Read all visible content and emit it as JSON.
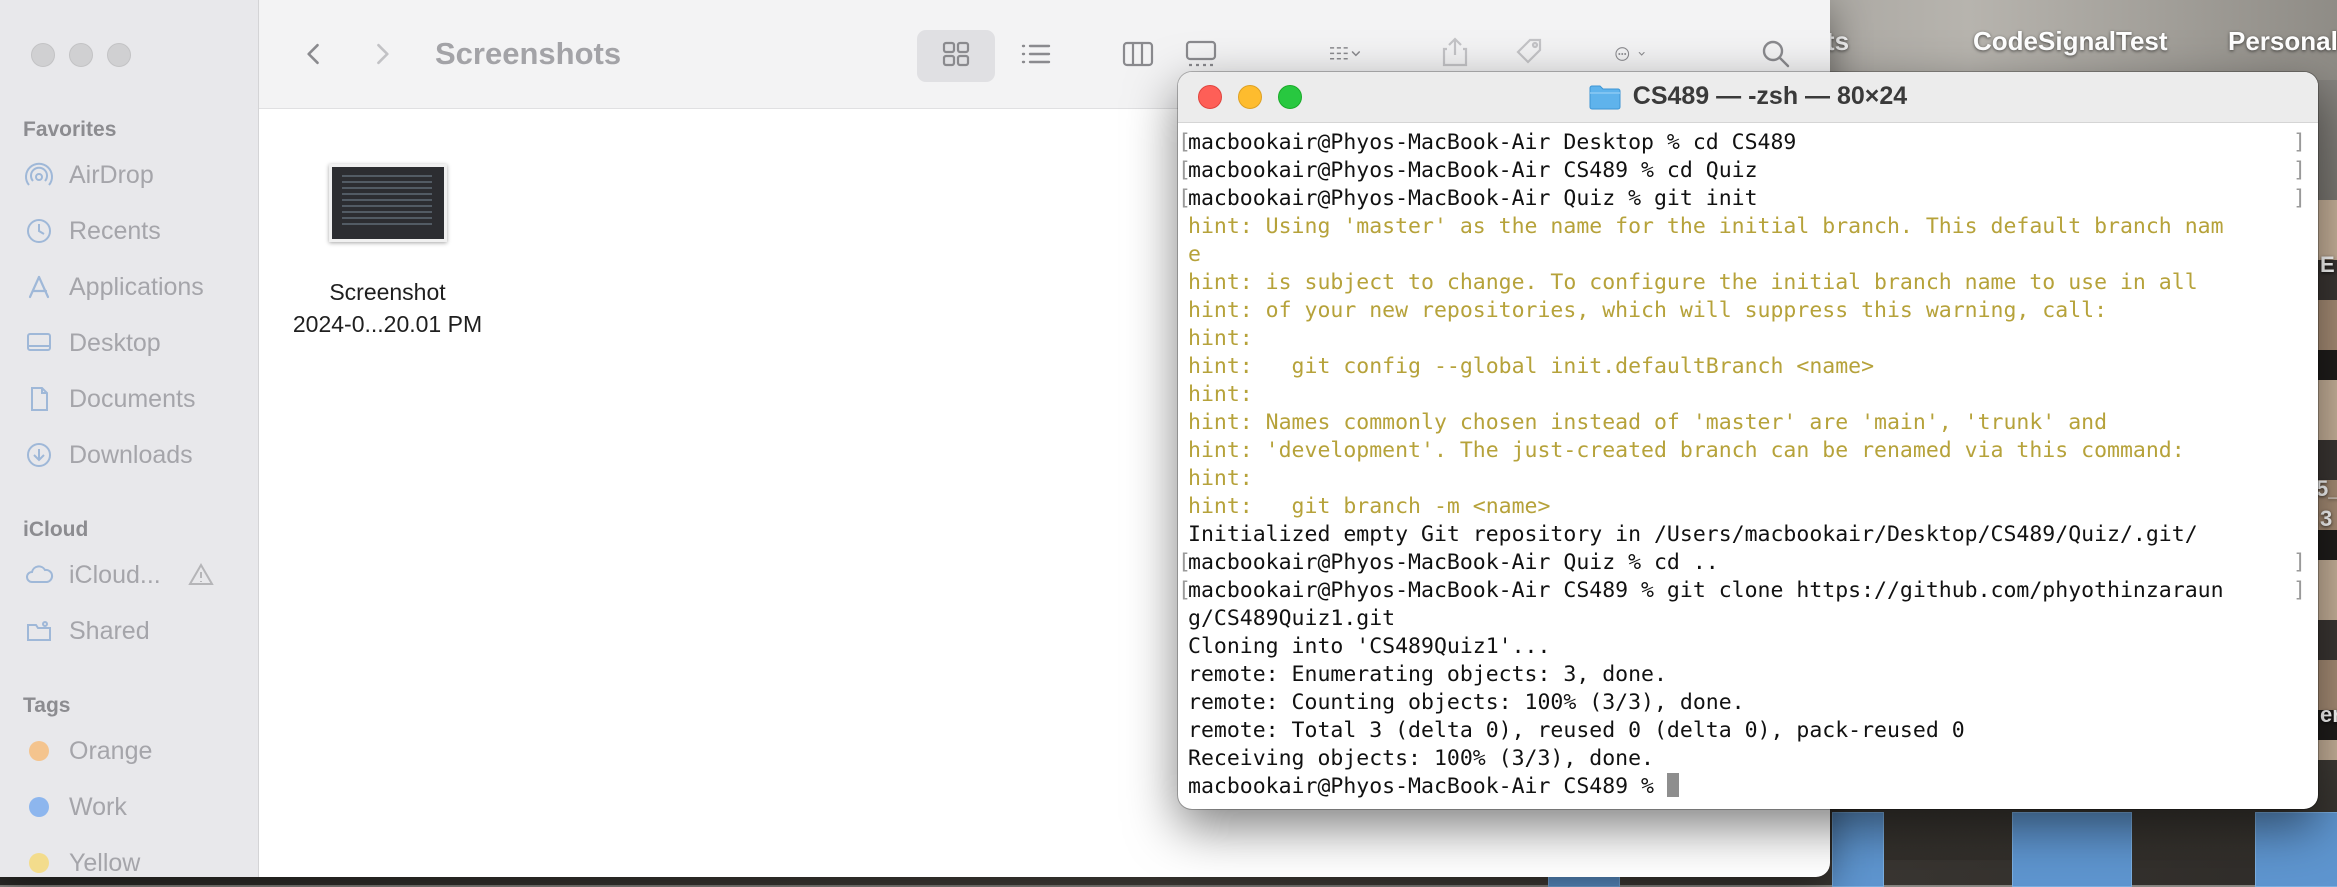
{
  "desktop": {
    "labels": [
      "ects",
      "CodeSignalTest",
      "Personal"
    ],
    "edge_texts": [
      "E",
      "5_",
      "3",
      "er"
    ]
  },
  "finder": {
    "title": "Screenshots",
    "sidebar": {
      "favorites_header": "Favorites",
      "favorites": [
        {
          "label": "AirDrop",
          "icon": "airdrop-icon"
        },
        {
          "label": "Recents",
          "icon": "clock-icon"
        },
        {
          "label": "Applications",
          "icon": "applications-icon"
        },
        {
          "label": "Desktop",
          "icon": "desktop-icon"
        },
        {
          "label": "Documents",
          "icon": "document-icon"
        },
        {
          "label": "Downloads",
          "icon": "download-icon"
        }
      ],
      "icloud_header": "iCloud",
      "icloud": [
        {
          "label": "iCloud...",
          "icon": "cloud-icon"
        },
        {
          "label": "Shared",
          "icon": "shared-folder-icon"
        }
      ],
      "tags_header": "Tags",
      "tags": [
        {
          "label": "Orange",
          "color": "#f4b774"
        },
        {
          "label": "Work",
          "color": "#6fa0e8"
        },
        {
          "label": "Yellow",
          "color": "#f2d46a"
        }
      ]
    },
    "files": [
      {
        "name_line1": "Screenshot",
        "name_line2": "2024-0...20.01 PM"
      }
    ]
  },
  "terminal": {
    "title": "CS489 — -zsh — 80×24",
    "lines": [
      {
        "type": "prompt",
        "text": "macbookair@Phyos-MacBook-Air Desktop % cd CS489"
      },
      {
        "type": "prompt",
        "text": "macbookair@Phyos-MacBook-Air CS489 % cd Quiz"
      },
      {
        "type": "prompt",
        "text": "macbookair@Phyos-MacBook-Air Quiz % git init"
      },
      {
        "type": "hint",
        "text": "hint: Using 'master' as the name for the initial branch. This default branch nam"
      },
      {
        "type": "hint",
        "text": "e"
      },
      {
        "type": "hint",
        "text": "hint: is subject to change. To configure the initial branch name to use in all"
      },
      {
        "type": "hint",
        "text": "hint: of your new repositories, which will suppress this warning, call:"
      },
      {
        "type": "hint",
        "text": "hint:"
      },
      {
        "type": "hint",
        "text": "hint:   git config --global init.defaultBranch <name>"
      },
      {
        "type": "hint",
        "text": "hint:"
      },
      {
        "type": "hint",
        "text": "hint: Names commonly chosen instead of 'master' are 'main', 'trunk' and"
      },
      {
        "type": "hint",
        "text": "hint: 'development'. The just-created branch can be renamed via this command:"
      },
      {
        "type": "hint",
        "text": "hint:"
      },
      {
        "type": "hint",
        "text": "hint:   git branch -m <name>"
      },
      {
        "type": "out",
        "text": "Initialized empty Git repository in /Users/macbookair/Desktop/CS489/Quiz/.git/"
      },
      {
        "type": "prompt",
        "text": "macbookair@Phyos-MacBook-Air Quiz % cd .."
      },
      {
        "type": "prompt",
        "text": "macbookair@Phyos-MacBook-Air CS489 % git clone https://github.com/phyothinzaraun"
      },
      {
        "type": "out",
        "text": "g/CS489Quiz1.git"
      },
      {
        "type": "out",
        "text": "Cloning into 'CS489Quiz1'..."
      },
      {
        "type": "out",
        "text": "remote: Enumerating objects: 3, done."
      },
      {
        "type": "out",
        "text": "remote: Counting objects: 100% (3/3), done."
      },
      {
        "type": "out",
        "text": "remote: Total 3 (delta 0), reused 0 (delta 0), pack-reused 0"
      },
      {
        "type": "out",
        "text": "Receiving objects: 100% (3/3), done."
      }
    ],
    "current_prompt": "macbookair@Phyos-MacBook-Air CS489 % "
  }
}
